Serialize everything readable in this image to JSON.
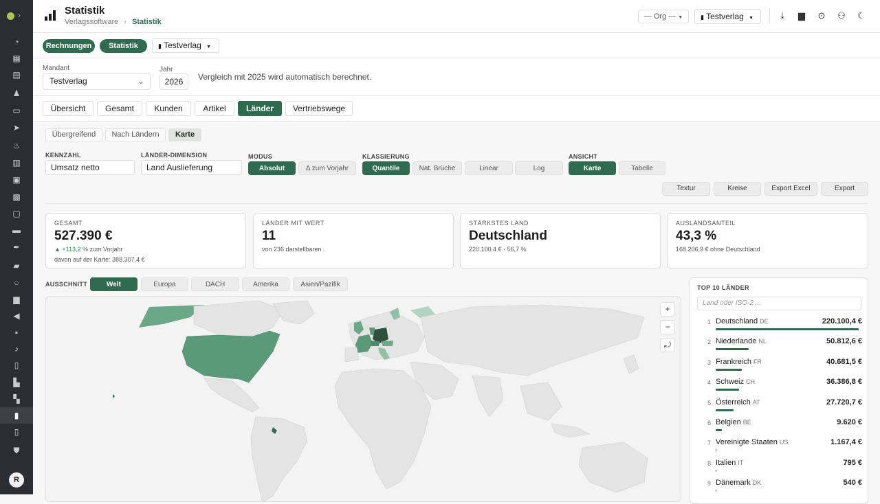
{
  "header": {
    "title": "Statistik",
    "crumb_root": "Verlagssoftware",
    "crumb_current": "Statistik",
    "org_select": "— Org —",
    "publisher_select": "Testverlag"
  },
  "toolbar": {
    "rechnungen": "Rechnungen",
    "statistik": "Statistik",
    "publisher": "Testverlag"
  },
  "filters": {
    "mandant_label": "Mandant",
    "mandant_value": "Testverlag",
    "jahr_label": "Jahr",
    "jahr_value": "2026",
    "note": "Vergleich mit 2025 wird automatisch berechnet."
  },
  "tabs": [
    "Übersicht",
    "Gesamt",
    "Kunden",
    "Artikel",
    "Länder",
    "Vertriebswege"
  ],
  "subtabs": [
    "Übergreifend",
    "Nach Ländern",
    "Karte"
  ],
  "controls": {
    "kennzahl_label": "KENNZAHL",
    "kennzahl_value": "Umsatz netto",
    "dim_label": "LÄNDER-DIMENSION",
    "dim_value": "Land Auslieferung",
    "modus_label": "MODUS",
    "modus": [
      "Absolut",
      "Δ zum Vorjahr"
    ],
    "klass_label": "KLASSIERUNG",
    "klass": [
      "Quantile",
      "Nat. Brüche",
      "Linear",
      "Log"
    ],
    "ansicht_label": "ANSICHT",
    "ansicht": [
      "Karte",
      "Tabelle"
    ],
    "actions": [
      "Textur",
      "Kreise",
      "Export Excel",
      "Export"
    ]
  },
  "kpis": [
    {
      "title": "GESAMT",
      "value": "527.390 €",
      "delta": "▲ +113,2",
      "delta_suffix": "% zum Vorjahr",
      "sub2": "davon auf der Karte: 388.307,4 €"
    },
    {
      "title": "LÄNDER MIT WERT",
      "value": "11",
      "sub": "von 236 darstellbaren"
    },
    {
      "title": "STÄRKSTES LAND",
      "value": "Deutschland",
      "sub": "220.100,4 € · 56,7 %"
    },
    {
      "title": "AUSLANDSANTEIL",
      "value": "43,3 %",
      "sub": "168.206,9 € ohne Deutschland"
    }
  ],
  "region": {
    "label": "AUSSCHNITT",
    "options": [
      "Welt",
      "Europa",
      "DACH",
      "Amerika",
      "Asien/Pazifik"
    ]
  },
  "map_controls": {
    "zoom_in": "+",
    "zoom_out": "−",
    "reset": "⤾"
  },
  "top10": {
    "title": "TOP 10 LÄNDER",
    "search_placeholder": "Land oder ISO-2 ...",
    "rows": [
      {
        "rank": "1",
        "name": "Deutschland",
        "iso": "DE",
        "value": "220.100,4 €",
        "share": 1.0
      },
      {
        "rank": "2",
        "name": "Niederlande",
        "iso": "NL",
        "value": "50.812,6 €",
        "share": 0.23
      },
      {
        "rank": "3",
        "name": "Frankreich",
        "iso": "FR",
        "value": "40.681,5 €",
        "share": 0.185
      },
      {
        "rank": "4",
        "name": "Schweiz",
        "iso": "CH",
        "value": "36.386,8 €",
        "share": 0.165
      },
      {
        "rank": "5",
        "name": "Österreich",
        "iso": "AT",
        "value": "27.720,7 €",
        "share": 0.126
      },
      {
        "rank": "6",
        "name": "Belgien",
        "iso": "BE",
        "value": "9.620 €",
        "share": 0.044
      },
      {
        "rank": "7",
        "name": "Vereinigte Staaten",
        "iso": "US",
        "value": "1.167,4 €",
        "share": 0.005
      },
      {
        "rank": "8",
        "name": "Italien",
        "iso": "IT",
        "value": "795 €",
        "share": 0.004
      },
      {
        "rank": "9",
        "name": "Dänemark",
        "iso": "DK",
        "value": "540 €",
        "share": 0.003
      }
    ]
  },
  "sidebar": {
    "avatar": "R"
  },
  "colors": {
    "accent": "#2f6b4f",
    "sidebar": "#2a2d31"
  }
}
